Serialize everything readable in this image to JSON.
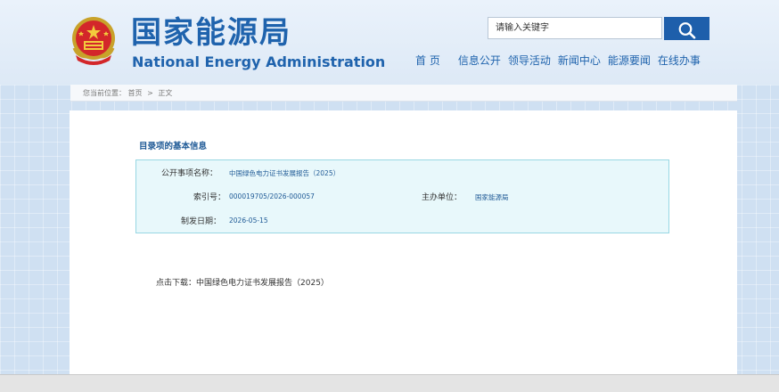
{
  "header": {
    "brand_cn": "国家能源局",
    "brand_en": "National Energy Administration",
    "search_placeholder": "请输入关键字",
    "nav": [
      "首 页",
      "信息公开",
      "领导活动",
      "新闻中心",
      "能源要闻",
      "在线办事"
    ]
  },
  "breadcrumb": {
    "prefix": "您当前位置：",
    "items": [
      "首页",
      "正文"
    ],
    "separator": ">"
  },
  "catalog": {
    "section_title": "目录项的基本信息",
    "fields": {
      "name_label": "公开事项名称：",
      "name_value": "中国绿色电力证书发展报告（2025）",
      "index_label": "索引号：",
      "index_value": "000019705/2026-000057",
      "org_label": "主办单位：",
      "org_value": "国家能源局",
      "date_label": "制发日期：",
      "date_value": "2026-05-15"
    }
  },
  "download": {
    "label": "点击下载：",
    "link": "中国绿色电力证书发展报告（2025）"
  },
  "colors": {
    "brand_blue": "#1f63ad",
    "search_button": "#1e5fab",
    "info_box_bg": "#e8f8fb",
    "info_box_border": "#98d7e3"
  },
  "icons": {
    "emblem": "national-emblem",
    "search": "search-icon"
  }
}
